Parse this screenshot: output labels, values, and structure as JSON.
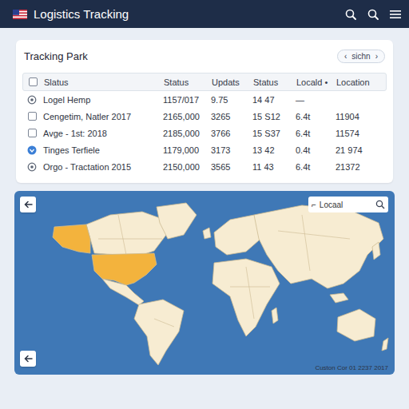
{
  "header": {
    "title": "Logistics Tracking"
  },
  "panel": {
    "title": "Tracking Park",
    "switcher": {
      "prev": "‹",
      "label": "sichn",
      "next": "›"
    }
  },
  "table": {
    "header_checked": false,
    "columns": [
      "Slatus",
      "Status",
      "Updats",
      "Status",
      "Locald •",
      "Location"
    ],
    "rows": [
      {
        "kind": "ring",
        "cells": [
          "Logel Hemp",
          "1157/017",
          "9.75",
          "14 47",
          "—",
          ""
        ]
      },
      {
        "kind": "checkbox",
        "checked": false,
        "cells": [
          "Cengetim, Natler 2017",
          "2165,000",
          "3265",
          "15 S12",
          "6.4t",
          "11904"
        ]
      },
      {
        "kind": "checkbox",
        "checked": false,
        "cells": [
          "Avge - 1st: 2018",
          "2185,000",
          "3766",
          "15 S37",
          "6.4t",
          "11574"
        ]
      },
      {
        "kind": "dot",
        "cells": [
          "Tinges Terfiele",
          "1179,000",
          "3173",
          "13 42",
          "0.4t",
          "21 974"
        ]
      },
      {
        "kind": "ring",
        "cells": [
          "Orgo - Tractation 2015",
          "2150,000",
          "3565",
          "11 43",
          "6.4t",
          "21372"
        ]
      }
    ]
  },
  "map": {
    "search": {
      "prefix": "⌐",
      "value": "Locaal"
    },
    "caption": "Custon Cor 01 2237 2017"
  }
}
